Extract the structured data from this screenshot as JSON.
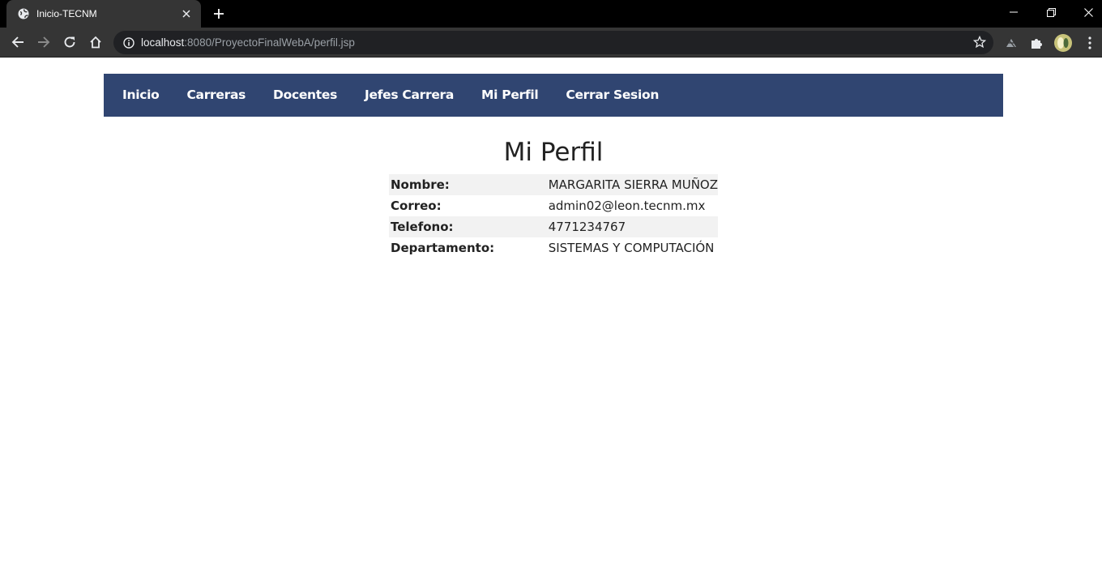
{
  "browser": {
    "tab_title": "Inicio-TECNM",
    "url_host": "localhost",
    "url_rest": ":8080/ProyectoFinalWebA/perfil.jsp"
  },
  "nav": {
    "items": [
      "Inicio",
      "Carreras",
      "Docentes",
      "Jefes Carrera",
      "Mi Perfil",
      "Cerrar Sesion"
    ]
  },
  "page": {
    "title": "Mi Perfil"
  },
  "profile": {
    "rows": [
      {
        "label": "Nombre:",
        "value": "MARGARITA SIERRA MUÑOZ"
      },
      {
        "label": "Correo:",
        "value": "admin02@leon.tecnm.mx"
      },
      {
        "label": "Telefono:",
        "value": "4771234767"
      },
      {
        "label": "Departamento:",
        "value": "SISTEMAS Y COMPUTACIÓN"
      }
    ]
  },
  "colors": {
    "nav_bg": "#304571",
    "row_shade": "#f2f2f2",
    "chrome_bg": "#353535",
    "tabstrip_bg": "#000000"
  },
  "icons": [
    "globe-icon",
    "close-icon",
    "plus-icon",
    "minimize-icon",
    "restore-icon",
    "window-close-icon",
    "back-arrow-icon",
    "forward-arrow-icon",
    "reload-icon",
    "home-icon",
    "info-icon",
    "star-icon",
    "extension-icon",
    "puzzle-icon",
    "profile-avatar-icon",
    "kebab-menu-icon"
  ]
}
